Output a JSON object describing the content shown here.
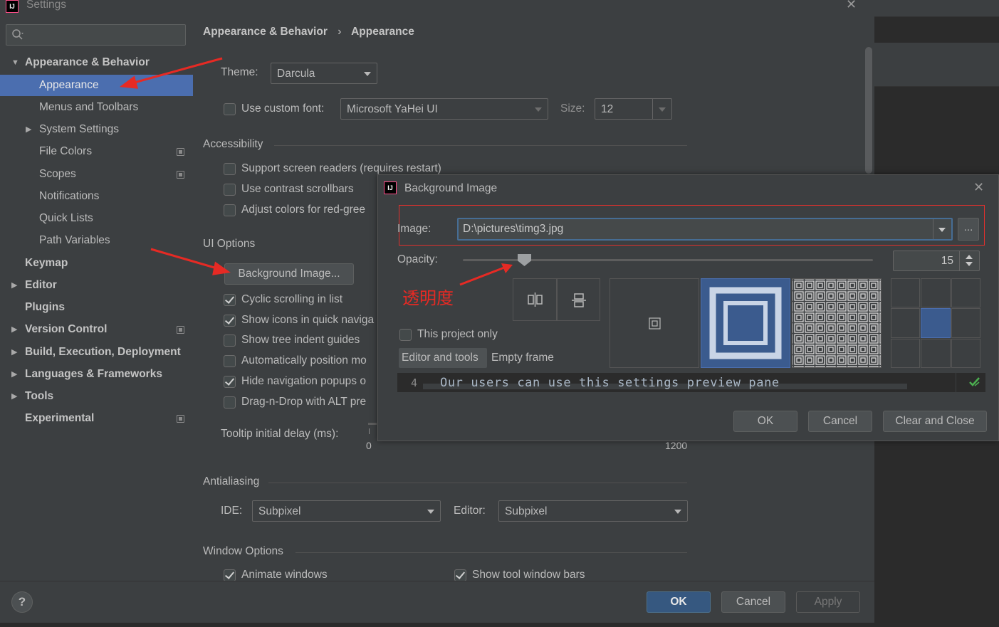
{
  "window": {
    "title": "Settings"
  },
  "search": {
    "placeholder": ""
  },
  "sidebar": {
    "items": [
      {
        "label": "Appearance & Behavior"
      },
      {
        "label": "Appearance"
      },
      {
        "label": "Menus and Toolbars"
      },
      {
        "label": "System Settings"
      },
      {
        "label": "File Colors"
      },
      {
        "label": "Scopes"
      },
      {
        "label": "Notifications"
      },
      {
        "label": "Quick Lists"
      },
      {
        "label": "Path Variables"
      },
      {
        "label": "Keymap"
      },
      {
        "label": "Editor"
      },
      {
        "label": "Plugins"
      },
      {
        "label": "Version Control"
      },
      {
        "label": "Build, Execution, Deployment"
      },
      {
        "label": "Languages & Frameworks"
      },
      {
        "label": "Tools"
      },
      {
        "label": "Experimental"
      }
    ]
  },
  "breadcrumb": {
    "parent": "Appearance & Behavior",
    "separator": "›",
    "current": "Appearance"
  },
  "theme": {
    "label": "Theme:",
    "value": "Darcula"
  },
  "font": {
    "checkbox_label": "Use custom font:",
    "value": "Microsoft YaHei UI",
    "size_label": "Size:",
    "size_value": "12"
  },
  "accessibility": {
    "title": "Accessibility",
    "items": [
      "Support screen readers (requires restart)",
      "Use contrast scrollbars",
      "Adjust colors for red-gree"
    ]
  },
  "ui_options": {
    "title": "UI Options",
    "bg_button": "Background Image...",
    "items": [
      "Cyclic scrolling in list",
      "Show icons in quick naviga",
      "Show tree indent guides",
      "Automatically position mo",
      "Hide navigation popups o",
      "Drag-n-Drop with ALT pre"
    ],
    "checked": [
      true,
      true,
      false,
      false,
      true,
      false
    ],
    "tooltip_label": "Tooltip initial delay (ms):",
    "tooltip_min": "0",
    "tooltip_max": "1200"
  },
  "antialiasing": {
    "title": "Antialiasing",
    "ide_label": "IDE:",
    "ide_value": "Subpixel",
    "editor_label": "Editor:",
    "editor_value": "Subpixel"
  },
  "window_options": {
    "title": "Window Options",
    "animate": "Animate windows",
    "show_bars": "Show tool window bars"
  },
  "footer": {
    "help": "?",
    "ok": "OK",
    "cancel": "Cancel",
    "apply": "Apply"
  },
  "dialog": {
    "title": "Background Image",
    "image_label": "Image:",
    "image_value": "D:\\pictures\\timg3.jpg",
    "browse": "...",
    "opacity_label": "Opacity:",
    "opacity": 15,
    "annotation": "透明度",
    "this_project_only": "This project only",
    "tab_editor": "Editor and tools",
    "tab_empty": "Empty frame",
    "preview_line_no": "4",
    "preview_text": "Our users can use this settings preview pane",
    "ok": "OK",
    "cancel": "Cancel",
    "clear_close": "Clear and Close"
  },
  "colors": {
    "selection": "#4b6eaf",
    "annotation_red": "#e62a24",
    "primary_button": "#365880"
  }
}
